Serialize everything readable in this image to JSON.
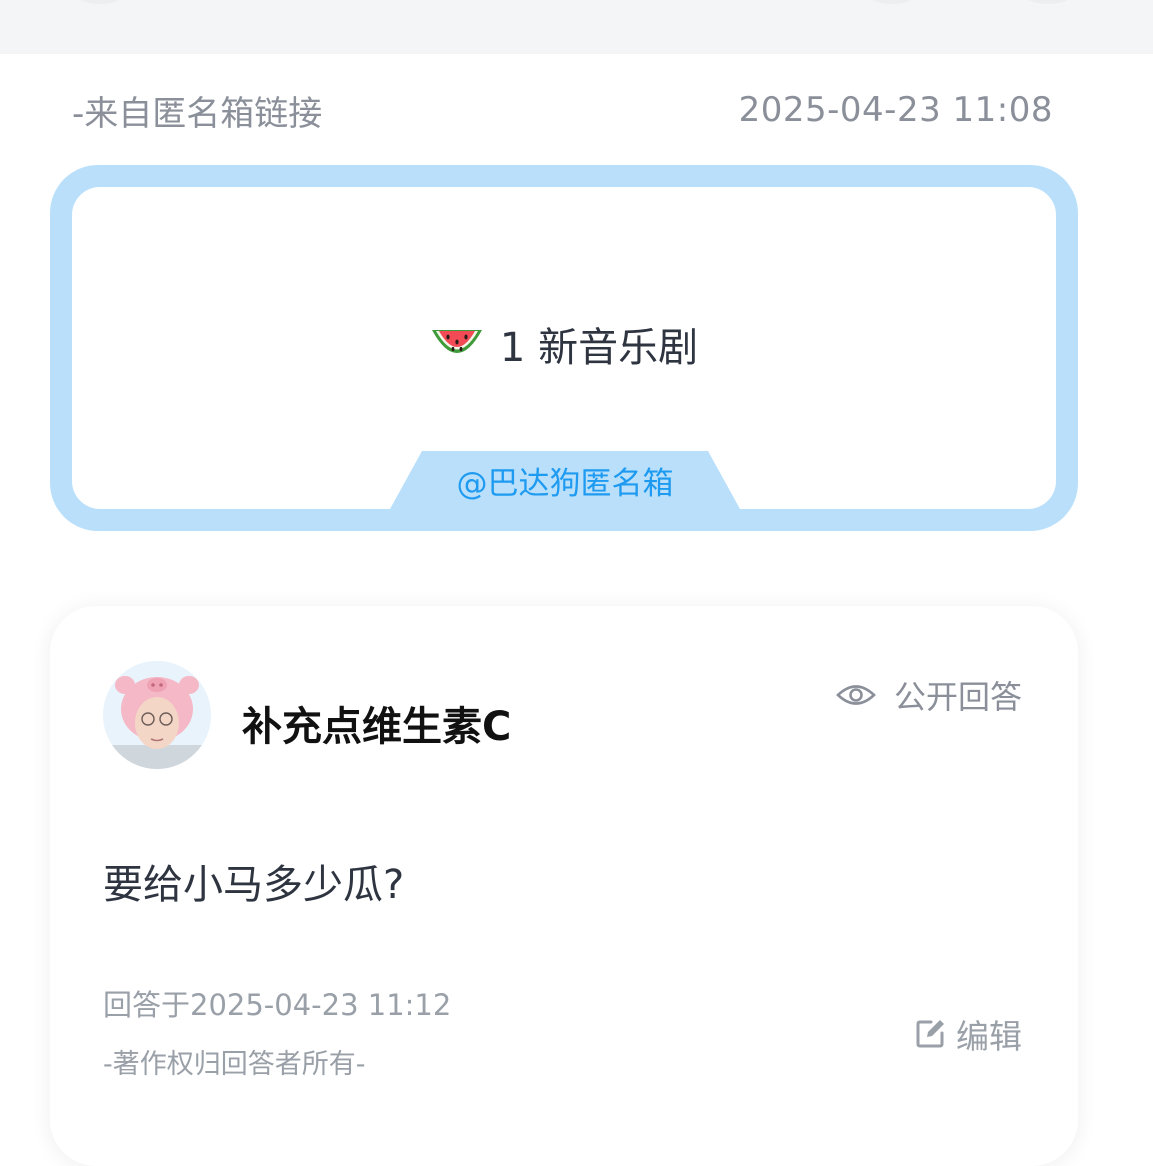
{
  "source": {
    "label": "-来自匿名箱链接",
    "timestamp": "2025-04-23 11:08"
  },
  "question": {
    "emoji_icon": "watermelon-icon",
    "text": "1 新音乐剧",
    "tag": "@巴达狗匿名箱",
    "accent_color": "#b9dffb",
    "tag_color": "#1e9bf0"
  },
  "answer": {
    "author_name": "补充点维生素C",
    "visibility_label": "公开回答",
    "visibility_icon": "eye-icon",
    "text": "要给小马多少瓜?",
    "answered_at": "回答于2025-04-23 11:12",
    "copyright": "-著作权归回答者所有-",
    "edit_label": "编辑",
    "edit_icon": "edit-icon"
  }
}
